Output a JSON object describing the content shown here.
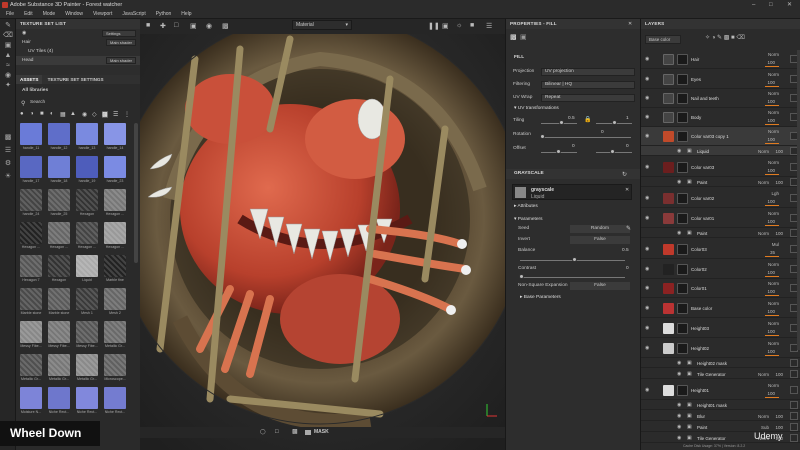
{
  "window": {
    "title": "Adobe Substance 3D Painter - Forest watcher"
  },
  "menu": [
    "File",
    "Edit",
    "Mode",
    "Window",
    "Viewport",
    "JavaScript",
    "Python",
    "Help"
  ],
  "texture_set_list": {
    "title": "TEXTURE SET LIST",
    "settings_label": "Settings",
    "sets": [
      {
        "name": "Hair",
        "shader": "Main shader"
      },
      {
        "name": "UV Tiles (4)",
        "shader": ""
      },
      {
        "name": "Head",
        "shader": "Main shader"
      }
    ]
  },
  "assets": {
    "tabs": [
      "ASSETS",
      "TEXTURE SET SETTINGS"
    ],
    "library": "All libraries",
    "search_placeholder": "Search",
    "items": [
      "handle_11",
      "handle_12",
      "handle_13",
      "handle_14",
      "handle_17",
      "handle_18",
      "handle_19",
      "handle_23",
      "handle_24",
      "handle_25",
      "Hexagon",
      "Hexagon ...",
      "Hexagon ...",
      "Hexagon ...",
      "Hexagon ...",
      "Hexagon ...",
      "Hexagon 7",
      "Hexagon",
      "Liquid",
      "Marble fine",
      "Marble stone",
      "Marble stone",
      "Mesh 1",
      "Mesh 2",
      "Messy Fibe...",
      "Messy Fibe...",
      "Messy Fibe...",
      "Metallic Gr...",
      "Metallic Gr...",
      "Metallic Gr...",
      "Metallic Gr...",
      "Microscope...",
      "Moisture N...",
      "Niche Rect...",
      "Niche Rect...",
      "Niche Rect..."
    ]
  },
  "viewport": {
    "material_mode": "Material",
    "overlay_mask": "MASK"
  },
  "properties": {
    "title": "PROPERTIES - FILL",
    "fill": {
      "projection_label": "Projection",
      "projection": "UV projection",
      "filtering_label": "Filtering",
      "filtering": "Bilinear | HQ",
      "uvwrap_label": "UV Wrap",
      "uvwrap": "Repeat"
    },
    "uv_transform": {
      "title": "UV transformations",
      "tiling_label": "Tiling",
      "tiling_a": "0.5",
      "tiling_b": "1",
      "rotation_label": "Rotation",
      "rotation": "0",
      "offset_label": "Offset",
      "offset_a": "0",
      "offset_b": "0"
    },
    "grayscale": {
      "title": "GRAYSCALE",
      "resource": "grayscale",
      "resource_sub": "Liquid"
    },
    "attributes_label": "Attributes",
    "parameters": {
      "title": "Parameters",
      "seed_label": "Seed",
      "seed": "Random",
      "invert_label": "Invert",
      "invert": "False",
      "balance_label": "Balance",
      "balance": "0.5",
      "contrast_label": "Contrast",
      "contrast": "0",
      "nsexp_label": "Non-Square Expansion",
      "nsexp": "False"
    },
    "base_params_label": "Base Parameters"
  },
  "layers": {
    "title": "LAYERS",
    "channel": "Base color",
    "rows": [
      {
        "name": "Hair",
        "blend": "Norm",
        "value": "100",
        "thumb": "#444"
      },
      {
        "name": "Eyes",
        "blend": "Norm",
        "value": "100",
        "thumb": "#444"
      },
      {
        "name": "Nail and teeth",
        "blend": "Norm",
        "value": "100",
        "thumb": "#444"
      },
      {
        "name": "Body",
        "blend": "Norm",
        "value": "100",
        "thumb": "#444"
      },
      {
        "name": "Color var03 copy 1",
        "blend": "Norm",
        "value": "100",
        "thumb": "#c04a2a"
      },
      {
        "name": "Color var03",
        "blend": "Norm",
        "value": "100",
        "thumb": "#6b1e1e"
      },
      {
        "name": "Color var02",
        "blend": "Lgh",
        "value": "100",
        "thumb": "#7a2f2f"
      },
      {
        "name": "Color var01",
        "blend": "Norm",
        "value": "100",
        "thumb": "#8a3a3a"
      },
      {
        "name": "Color03",
        "blend": "Mul",
        "value": "35",
        "thumb": "#c0392b"
      },
      {
        "name": "Color02",
        "blend": "Norm",
        "value": "100",
        "thumb": "#222"
      },
      {
        "name": "Color01",
        "blend": "Norm",
        "value": "100",
        "thumb": "#8b2222"
      },
      {
        "name": "Base color",
        "blend": "Norm",
        "value": "100",
        "thumb": "#b33"
      },
      {
        "name": "Height03",
        "blend": "Norm",
        "value": "100",
        "thumb": "#ddd"
      },
      {
        "name": "Height02",
        "blend": "Norm",
        "value": "100",
        "thumb": "#ccc"
      },
      {
        "name": "Height01",
        "blend": "Norm",
        "value": "100",
        "thumb": "#ddd"
      }
    ],
    "sub_rows": {
      "liquid": {
        "name": "Liquid",
        "blend": "Norm",
        "value": "100"
      },
      "paint1": {
        "name": "Paint",
        "blend": "Norm",
        "value": "100"
      },
      "paint2": {
        "name": "Paint",
        "blend": "Norm",
        "value": "100"
      },
      "h2mask": {
        "name": "Height02 mask"
      },
      "tilegen1": {
        "name": "Tile Generator",
        "blend": "Norm",
        "value": "100"
      },
      "h1mask": {
        "name": "Height01 mask"
      },
      "blur": {
        "name": "Blur",
        "blend": "Norm",
        "value": "100"
      },
      "paint3": {
        "name": "Paint",
        "blend": "Sub",
        "value": "100"
      },
      "tilegen2": {
        "name": "Tile Generator",
        "blend": "Norm",
        "value": "100"
      }
    }
  },
  "overlay": {
    "keypress": "Wheel Down",
    "watermark": "Udemy",
    "cache": "Cache Disk Usage: 37% | Version: 8.2.2"
  },
  "colors": {
    "accent": "#e07b20",
    "panel": "#2d2d2d",
    "header": "#333333"
  }
}
